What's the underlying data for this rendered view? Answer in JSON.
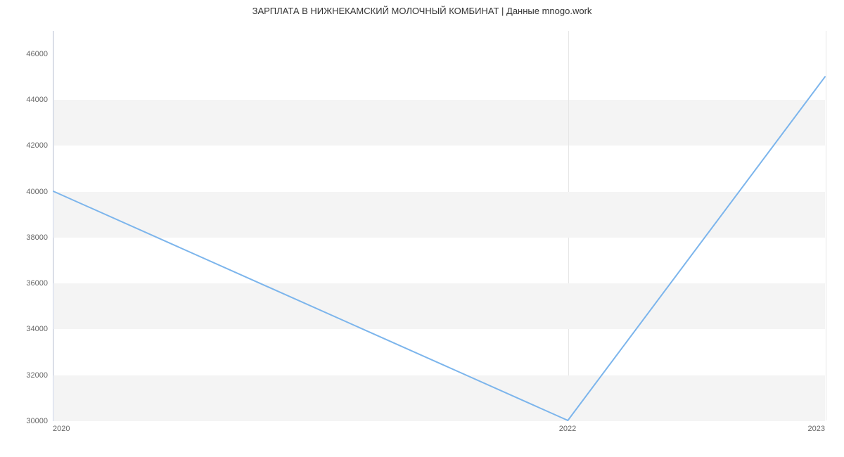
{
  "chart_data": {
    "type": "line",
    "title": "ЗАРПЛАТА В НИЖНЕКАМСКИЙ МОЛОЧНЫЙ КОМБИНАТ | Данные mnogo.work",
    "x": [
      2020,
      2022,
      2023
    ],
    "values": [
      40000,
      30000,
      45000
    ],
    "x_ticks": [
      2020,
      2022,
      2023
    ],
    "y_ticks": [
      30000,
      32000,
      34000,
      36000,
      38000,
      40000,
      42000,
      44000,
      46000
    ],
    "ylim": [
      30000,
      47000
    ],
    "xlabel": "",
    "ylabel": "",
    "line_color": "#7cb5ec"
  }
}
